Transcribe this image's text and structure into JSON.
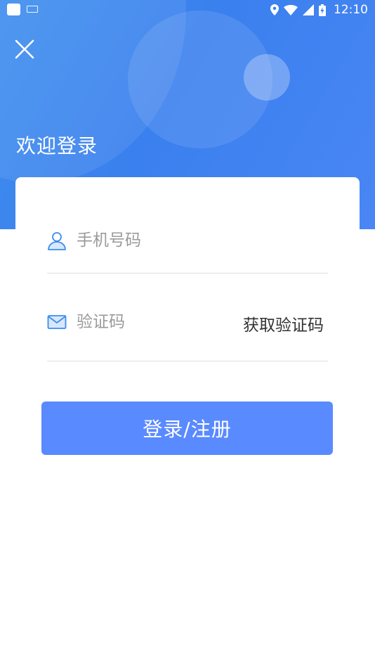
{
  "status_bar": {
    "time": "12:10"
  },
  "header": {
    "title": "欢迎登录",
    "close_icon": "close-icon"
  },
  "form": {
    "phone": {
      "placeholder": "手机号码",
      "value": "",
      "icon": "user-icon"
    },
    "code": {
      "placeholder": "验证码",
      "value": "",
      "icon": "mail-icon",
      "get_code_label": "获取验证码"
    }
  },
  "login_button_label": "登录/注册",
  "colors": {
    "accent": "#5a8aff",
    "header_start": "#3f8fee",
    "header_end": "#4a86f5"
  }
}
